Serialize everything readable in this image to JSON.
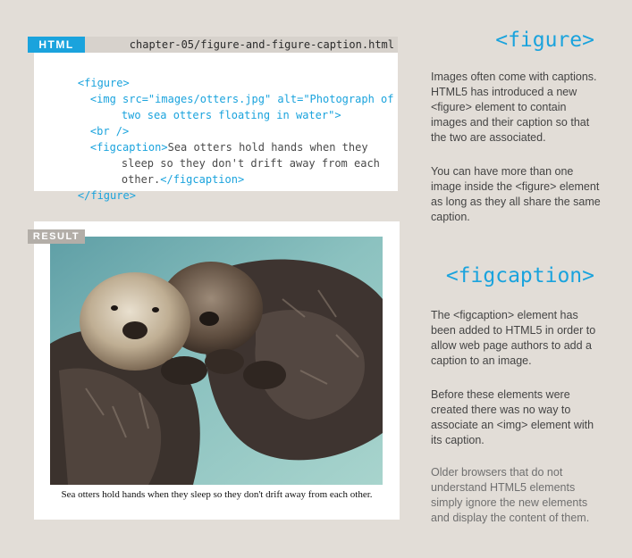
{
  "code_panel": {
    "label": "HTML",
    "filename": "chapter-05/figure-and-figure-caption.html",
    "lines": {
      "l1": "<figure>",
      "l2": "<img src=\"images/otters.jpg\" alt=\"Photograph of",
      "l3": "two sea otters floating in water\">",
      "l4": "<br />",
      "l5_tag": "<figcaption>",
      "l5_text": "Sea otters hold hands when they",
      "l6": "sleep so they don't drift away from each",
      "l7_text": "other.",
      "l7_tag": "</figcaption>",
      "l8": "</figure>"
    }
  },
  "result_panel": {
    "label": "RESULT",
    "caption": "Sea otters hold hands when they sleep so they don't drift away from each other."
  },
  "sidebar": {
    "figure_heading": "<figure>",
    "figure_p1": "Images often come with captions. HTML5 has introduced a new <figure> element to contain images and their caption so that the two are associated.",
    "figure_p2": "You can have more than one image inside the <figure> element as long as they all share the same caption.",
    "figcaption_heading": "<figcaption>",
    "figcaption_p1": "The <figcaption> element has been added to HTML5 in order to allow web page authors to add a caption to an image.",
    "figcaption_p2": "Before these elements were created there was no way to associate an <img> element with its caption.",
    "figcaption_p3": "Older browsers that do not understand HTML5 elements simply ignore the new elements and display the content of them."
  },
  "colors": {
    "accent": "#1aa3dd",
    "page_bg": "#e2ddd7",
    "result_tag": "#b3aea8"
  }
}
